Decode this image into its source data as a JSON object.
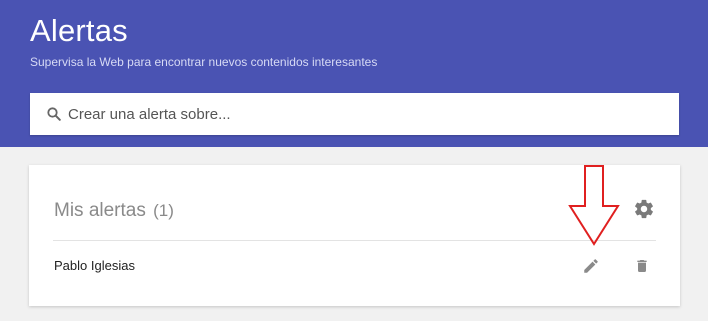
{
  "header": {
    "title": "Alertas",
    "subtitle": "Supervisa la Web para encontrar nuevos contenidos interesantes",
    "background_color": "#4a53b3"
  },
  "search": {
    "placeholder": "Crear una alerta sobre...",
    "value": "",
    "icon": "search-icon"
  },
  "my_alerts": {
    "title": "Mis alertas",
    "count": "(1)",
    "settings_icon": "gear-icon",
    "items": [
      {
        "name": "Pablo Iglesias",
        "edit_icon": "pencil-icon",
        "delete_icon": "trash-icon"
      }
    ]
  },
  "annotation": {
    "icon": "down-arrow-icon",
    "color": "#e02020"
  }
}
